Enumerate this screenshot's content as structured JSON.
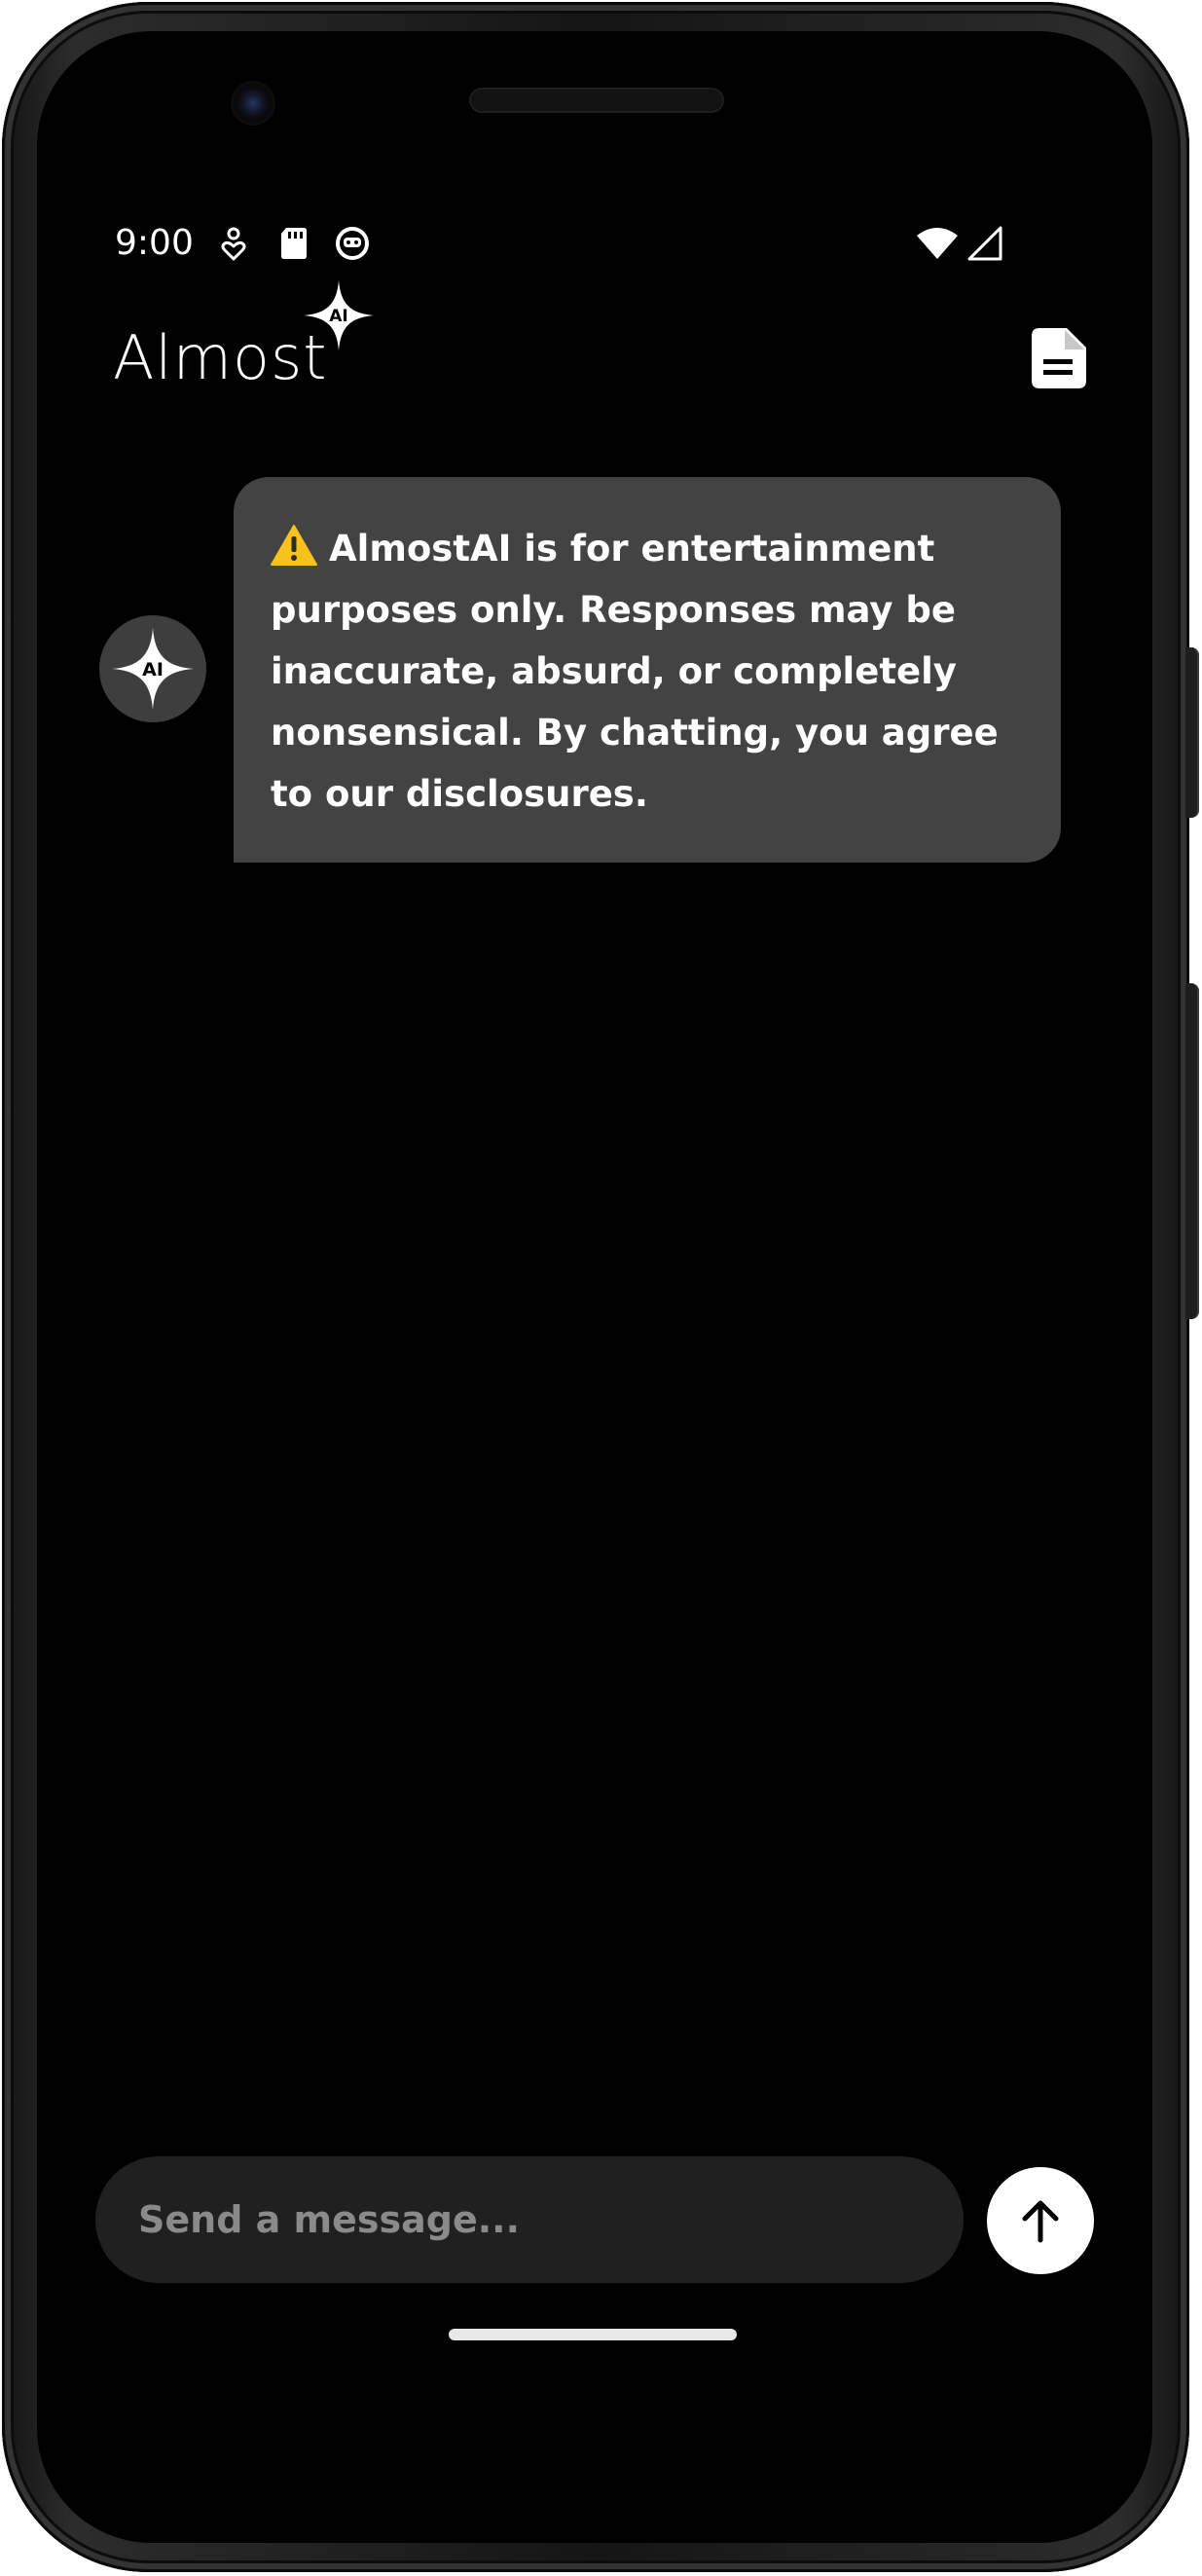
{
  "status_bar": {
    "time": "9:00",
    "icons": [
      "notification-icon",
      "sd-card-icon",
      "app-badge-icon",
      "wifi-icon",
      "signal-icon"
    ]
  },
  "header": {
    "title": "Almost",
    "logo_badge": "AI",
    "document_icon": "document-icon"
  },
  "messages": [
    {
      "sender": "AI",
      "avatar_label": "AI",
      "warning_icon": "warning-icon",
      "text": "AlmostAI is for entertainment purposes only. Responses may be inaccurate, absurd, or completely nonsensical. By chatting, you agree to our disclosures."
    }
  ],
  "composer": {
    "placeholder": "Send a message...",
    "value": "",
    "send_icon": "arrow-up-icon"
  },
  "colors": {
    "background": "#000000",
    "bubble": "#434343",
    "avatar": "#3e3e3e",
    "composer": "#202020",
    "placeholder": "#8a8a8a",
    "warning": "#f7c21b"
  }
}
